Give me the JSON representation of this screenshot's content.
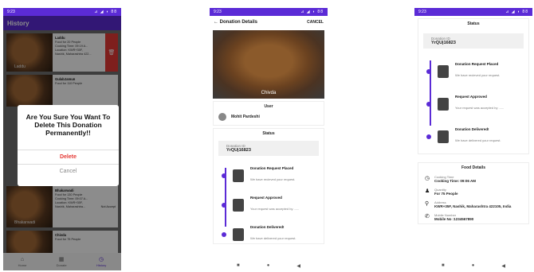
{
  "phone1": {
    "status_time": "9:23",
    "status_right": "⊿ ◢ ◗ 88",
    "title": "History",
    "cards": [
      {
        "thumb_label": "Laddu",
        "name": "Laddu",
        "lines": [
          "Food for 20 People",
          "Cooking Time: 09:19 A...",
          "Location: KWR+35F,",
          "Nashik, Maharashtra 422..."
        ]
      },
      {
        "thumb_label": "",
        "name": "GulabJamun",
        "lines": [
          "Food for 110 People",
          ""
        ]
      },
      {
        "thumb_label": "Bhakarwadi",
        "name": "Bhakarwadi",
        "lines": [
          "Food for 130 People",
          "Cooking Time: 09:07 A...",
          "Location: KWR+35F,",
          "Nashik, Maharashtra..."
        ],
        "accept": "Not Accept"
      },
      {
        "thumb_label": "",
        "name": "Chivda",
        "lines": [
          "Food for 75 People"
        ]
      }
    ],
    "dialog": {
      "message": "Are You Sure You Want To Delete This Donation Permanently!!",
      "delete": "Delete",
      "cancel": "Cancel"
    },
    "nav": [
      {
        "icon": "⌂",
        "label": "Home"
      },
      {
        "icon": "▦",
        "label": "Donate"
      },
      {
        "icon": "◷",
        "label": "History"
      }
    ]
  },
  "phone2": {
    "status_time": "9:23",
    "status_right": "⊿ ◢ ◗ 88",
    "title": "Donation Details",
    "cancel": "CANCEL",
    "food_label": "Chivda",
    "user_title": "User",
    "user_name": "Mohit Pardeshi",
    "status_title": "Status",
    "donation_id_label": "Donation ID",
    "donation_id": "YrQUj16823",
    "timeline": [
      {
        "title": "Donation Request Placed",
        "desc": "We have recieved your request."
      },
      {
        "title": "Request Approved",
        "desc": "Your request was accepted by ......"
      },
      {
        "title": "Donation Delivered!",
        "desc": "We have delivered your request."
      }
    ]
  },
  "phone3": {
    "status_time": "9:23",
    "status_right": "⊿ ◢ ◗ 88",
    "status_title": "Status",
    "donation_id_label": "Donation ID",
    "donation_id": "YrQUj16823",
    "timeline": [
      {
        "title": "Donation Request Placed",
        "desc": "We have recieved your request."
      },
      {
        "title": "Request Approved",
        "desc": "Your request was accepted by ......"
      },
      {
        "title": "Donation Delivered!",
        "desc": "We have delivered your request."
      }
    ],
    "food_details_title": "Food Details",
    "details": [
      {
        "icon": "◷",
        "label": "Cooking Time",
        "value": "Cooking Time: 09:06 AM"
      },
      {
        "icon": "♟",
        "label": "Quantity",
        "value": "For 75 People"
      },
      {
        "icon": "⚲",
        "label": "Address",
        "value": "KWR+35F, Nashik, Maharashtra 422105, India"
      },
      {
        "icon": "✆",
        "label": "Mobile Number",
        "value": "Mobile No :1234567890"
      }
    ]
  },
  "sysnav": {
    "square": "■",
    "circle": "●",
    "back": "◀"
  },
  "colors": {
    "primary": "#5b2bd6",
    "danger": "#e53935"
  }
}
